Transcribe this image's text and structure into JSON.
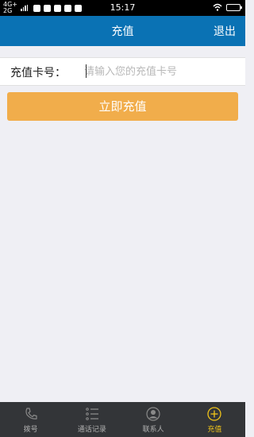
{
  "status_bar": {
    "network_top": "4G+",
    "network_bottom": "2G",
    "time": "15:17"
  },
  "header": {
    "title": "充值",
    "logout_label": "退出"
  },
  "form": {
    "card_label": "充值卡号：",
    "card_placeholder": "请输入您的充值卡号",
    "card_value": ""
  },
  "recharge_button_label": "立即充值",
  "tabs": [
    {
      "label": "拨号",
      "icon": "phone-icon",
      "active": false
    },
    {
      "label": "通话记录",
      "icon": "list-icon",
      "active": false
    },
    {
      "label": "联系人",
      "icon": "contact-icon",
      "active": false
    },
    {
      "label": "充值",
      "icon": "plus-circle-icon",
      "active": true
    }
  ],
  "colors": {
    "header": "#0a72b4",
    "button": "#f1ad4b",
    "tab_active": "#f0c419",
    "tabbar": "#333538",
    "background": "#efeff4"
  }
}
